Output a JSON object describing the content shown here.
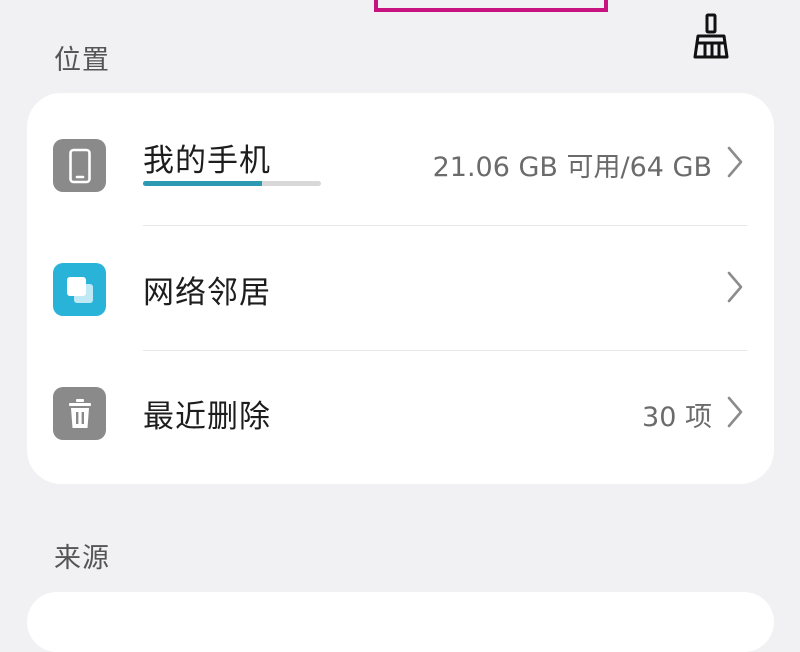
{
  "sections": {
    "location_label": "位置",
    "sources_label": "来源"
  },
  "icons": {
    "clean": "broom-icon",
    "phone": "phone-icon",
    "network": "network-neighborhood-icon",
    "trash": "trash-icon",
    "chevron": "chevron-right-icon"
  },
  "storage": {
    "title": "我的手机",
    "capacity_text": "21.06 GB 可用/64 GB",
    "used_fraction": 0.67
  },
  "network": {
    "title": "网络邻居"
  },
  "recently_deleted": {
    "title": "最近删除",
    "count_text": "30 项"
  },
  "colors": {
    "accent": "#2d9ab1",
    "network_icon_bg": "#29b3d9",
    "grey_icon_bg": "#8a8a8a",
    "highlight_border": "#c7137f"
  }
}
